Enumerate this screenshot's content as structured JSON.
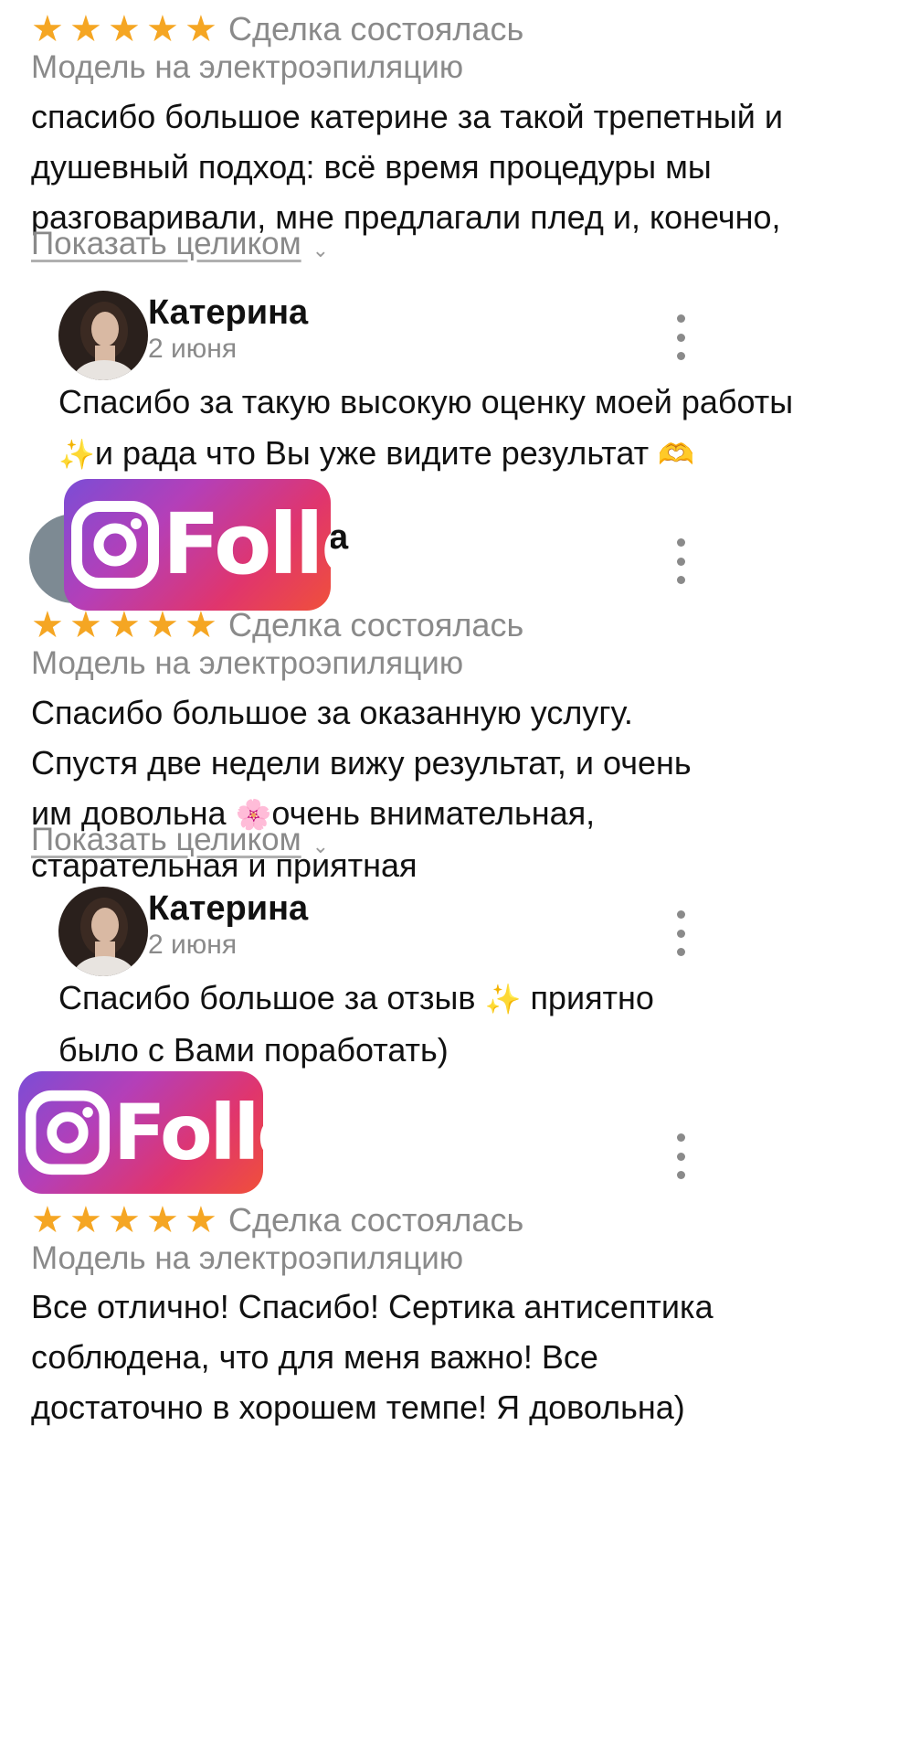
{
  "reviews": [
    {
      "deal_status": "Сделка состоялась",
      "service": "Модель на электроэпиляцию",
      "text": "спасибо большое катерине за такой трепетный и душевный подход: всё время процедуры мы разговаривали, мне предлагали плед и, конечно,",
      "show_more": "Показать целиком",
      "reply": {
        "author": "Катерина",
        "date": "2 июня",
        "text_part1": "Спасибо за такую высокую оценку моей работы",
        "emoji1": "✨",
        "text_part2": "и рада что Вы уже видите результат",
        "emoji2": "🫶"
      }
    },
    {
      "author_partial": "а",
      "deal_status": "Сделка состоялась",
      "service": "Модель на электроэпиляцию",
      "text_part1": "Спасибо большое за оказанную услугу.  Спустя две недели вижу результат, и очень им довольна",
      "emoji": "🌸",
      "text_part2": "очень внимательная, старательная и приятная",
      "show_more": "Показать целиком",
      "reply": {
        "author": "Катерина",
        "date": "2 июня",
        "text_part1": "Спасибо большое за отзыв",
        "emoji": "✨",
        "text_part2": "приятно было с Вами поработать)"
      }
    },
    {
      "deal_status": "Сделка состоялась",
      "service": "Модель на электроэпиляцию",
      "text": "Все отлично! Спасибо! Сертика антисептика соблюдена, что для меня важно! Все достаточно в хорошем темпе! Я довольна)"
    }
  ],
  "follow_badge": {
    "label": "Follow",
    "icon": "instagram-icon"
  },
  "rating_stars": 5,
  "colors": {
    "star": "#F5A623",
    "muted": "#8a8a8a"
  }
}
